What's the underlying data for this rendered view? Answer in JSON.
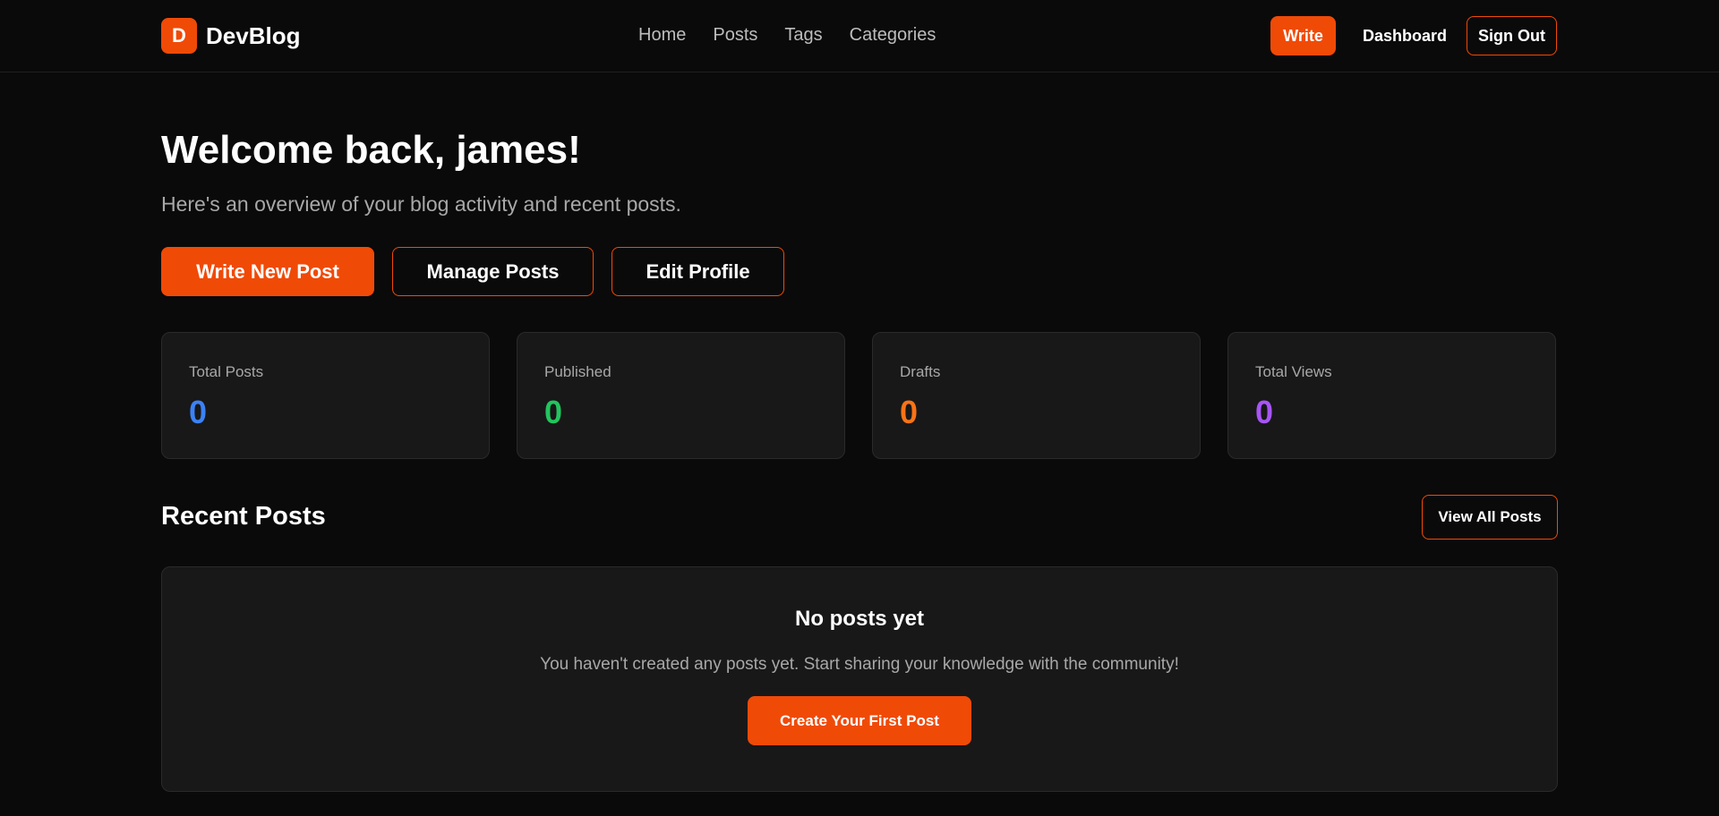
{
  "header": {
    "logo_letter": "D",
    "brand": "DevBlog",
    "nav": [
      "Home",
      "Posts",
      "Tags",
      "Categories"
    ],
    "write": "Write",
    "dashboard": "Dashboard",
    "sign_out": "Sign Out"
  },
  "welcome": {
    "title": "Welcome back, james!",
    "subtitle": "Here's an overview of your blog activity and recent posts."
  },
  "actions": {
    "write_new": "Write New Post",
    "manage": "Manage Posts",
    "edit_profile": "Edit Profile"
  },
  "stats": [
    {
      "label": "Total Posts",
      "value": "0",
      "color": "#3b82f6"
    },
    {
      "label": "Published",
      "value": "0",
      "color": "#22c55e"
    },
    {
      "label": "Drafts",
      "value": "0",
      "color": "#f97316"
    },
    {
      "label": "Total Views",
      "value": "0",
      "color": "#a855f7"
    }
  ],
  "recent": {
    "title": "Recent Posts",
    "view_all": "View All Posts",
    "empty_title": "No posts yet",
    "empty_text": "You haven't created any posts yet. Start sharing your knowledge with the community!",
    "create_first": "Create Your First Post"
  },
  "colors": {
    "accent": "#f04a07",
    "background": "#0a0a0a",
    "card": "#181818"
  }
}
